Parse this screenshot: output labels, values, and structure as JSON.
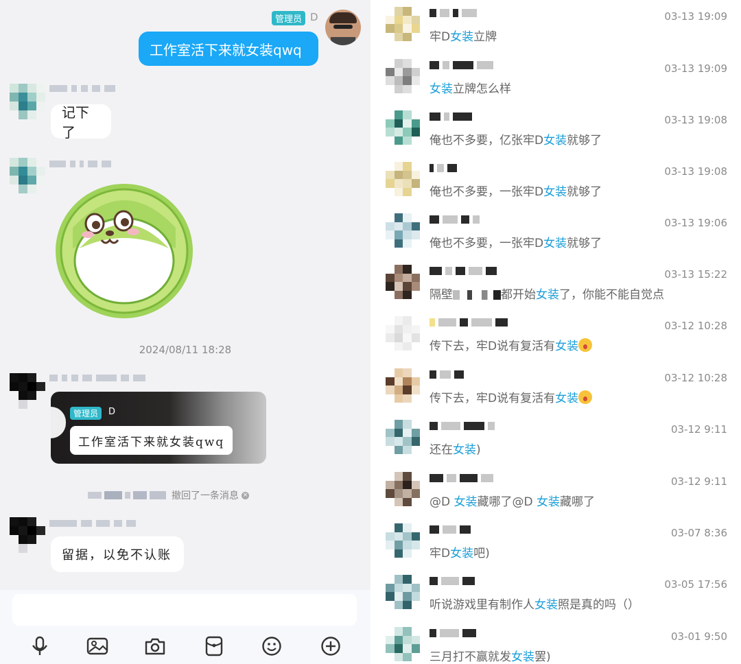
{
  "chat": {
    "admin_badge": "管理员",
    "admin_name": "D",
    "my_message": "工作室活下来就女装qwq",
    "reply_1": "记下了",
    "timestamp": "2024/08/11 18:28",
    "quote_badge": "管理员",
    "quote_name": "D",
    "quote_text": "工作室活下来就女装qwq",
    "recall_notice": "撤回了一条消息",
    "reply_2": "留据，以免不认账",
    "input": {
      "value": "",
      "placeholder": ""
    },
    "toolbar_icons": [
      "microphone-icon",
      "image-icon",
      "camera-icon",
      "red-packet-icon",
      "emoji-icon",
      "plus-icon"
    ]
  },
  "results": [
    {
      "time": "03-13 19:09",
      "pre": "牢D",
      "hl": "女装",
      "post": "立牌",
      "extra_hl": "",
      "extra_post": "",
      "emoji": false
    },
    {
      "time": "03-13 19:09",
      "pre": "",
      "hl": "女装",
      "post": "立牌怎么样",
      "extra_hl": "",
      "extra_post": "",
      "emoji": false
    },
    {
      "time": "03-13 19:08",
      "pre": "俺也不多要，亿张牢D",
      "hl": "女装",
      "post": "就够了",
      "extra_hl": "",
      "extra_post": "",
      "emoji": false
    },
    {
      "time": "03-13 19:08",
      "pre": "俺也不多要，一张牢D",
      "hl": "女装",
      "post": "就够了",
      "extra_hl": "",
      "extra_post": "",
      "emoji": false
    },
    {
      "time": "03-13 19:06",
      "pre": "俺也不多要，一张牢D",
      "hl": "女装",
      "post": "就够了",
      "extra_hl": "",
      "extra_post": "",
      "emoji": false
    },
    {
      "time": "03-13 15:22",
      "pre": "隔壁",
      "hl": "女装",
      "post": "了，你能不能自觉点",
      "mid": "都开始",
      "extra_hl": "",
      "extra_post": "",
      "emoji": false
    },
    {
      "time": "03-12 10:28",
      "pre": "传下去，牢D说有复活有",
      "hl": "女装",
      "post": "",
      "extra_hl": "",
      "extra_post": "",
      "emoji": true
    },
    {
      "time": "03-12 10:28",
      "pre": "传下去，牢D说有复活有",
      "hl": "女装",
      "post": "",
      "extra_hl": "",
      "extra_post": "",
      "emoji": true
    },
    {
      "time": "03-12 9:11",
      "pre": "还在",
      "hl": "女装",
      "post": ")",
      "extra_hl": "",
      "extra_post": "",
      "emoji": false
    },
    {
      "time": "03-12 9:11",
      "pre": "@D  ",
      "hl": "女装",
      "post": "藏哪了@D  ",
      "extra_hl": "女装",
      "extra_post": "藏哪了",
      "emoji": false
    },
    {
      "time": "03-07 8:36",
      "pre": "牢D",
      "hl": "女装",
      "post": "吧)",
      "extra_hl": "",
      "extra_post": "",
      "emoji": false
    },
    {
      "time": "03-05 17:56",
      "pre": "听说游戏里有制作人",
      "hl": "女装",
      "post": "照是真的吗（）",
      "extra_hl": "",
      "extra_post": "",
      "emoji": false
    },
    {
      "time": "03-01 9:50",
      "pre": "三月打不赢就发",
      "hl": "女装",
      "post": "罢)",
      "extra_hl": "",
      "extra_post": "",
      "emoji": false
    }
  ],
  "colors": {
    "my_bubble": "#1aa8f7",
    "highlight": "#1a9ed8",
    "admin_badge": "#2fb8c9",
    "chat_bg": "#f2f2f4"
  }
}
